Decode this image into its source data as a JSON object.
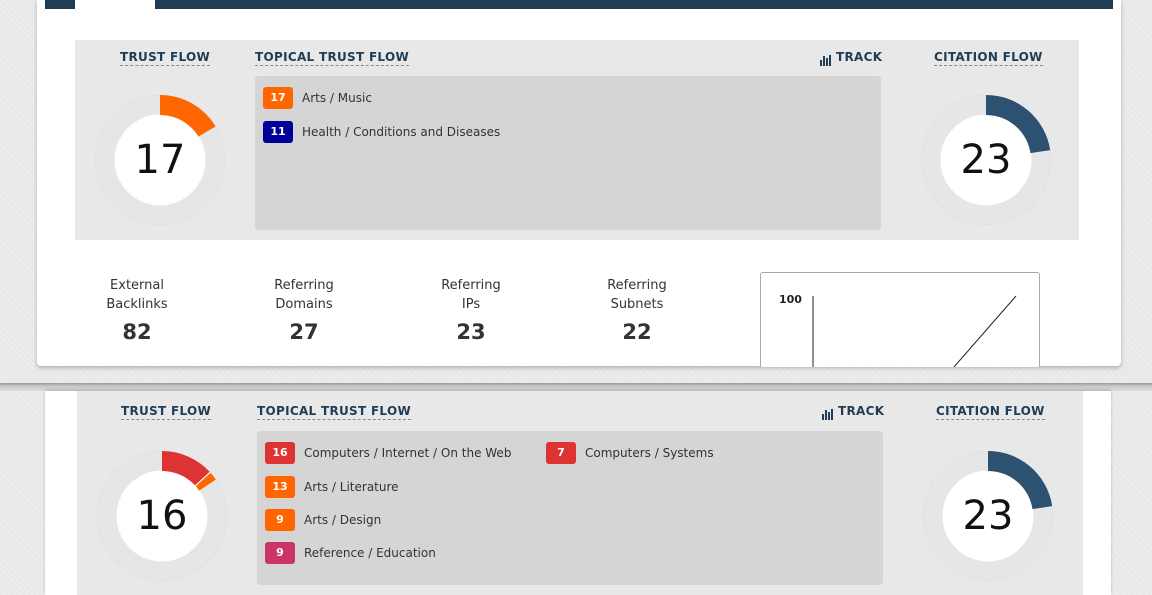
{
  "report1": {
    "trust_flow": {
      "label": "TRUST FLOW",
      "value": "17",
      "color": "#ff6600"
    },
    "topical": {
      "label": "TOPICAL TRUST FLOW",
      "items": [
        {
          "score": "17",
          "label": "Arts / Music",
          "color": "#ff6600"
        },
        {
          "score": "11",
          "label": "Health / Conditions and Diseases",
          "color": "#000099"
        }
      ]
    },
    "track_label": "TRACK",
    "citation_flow": {
      "label": "CITATION FLOW",
      "value": "23",
      "color": "#2c5171"
    },
    "stats": [
      {
        "line1": "External",
        "line2": "Backlinks",
        "value": "82"
      },
      {
        "line1": "Referring",
        "line2": "Domains",
        "value": "27"
      },
      {
        "line1": "Referring",
        "line2": "IPs",
        "value": "23"
      },
      {
        "line1": "Referring",
        "line2": "Subnets",
        "value": "22"
      }
    ],
    "chart": {
      "y_max_label": "100"
    }
  },
  "report2": {
    "trust_flow": {
      "label": "TRUST FLOW",
      "value": "16",
      "colors": [
        "#dd3333",
        "#ff6600"
      ]
    },
    "topical": {
      "label": "TOPICAL TRUST FLOW",
      "items": [
        {
          "score": "16",
          "label": "Computers / Internet / On the Web",
          "color": "#dd3333"
        },
        {
          "score": "7",
          "label": "Computers / Systems",
          "color": "#dd3333"
        },
        {
          "score": "13",
          "label": "Arts / Literature",
          "color": "#ff6600"
        },
        {
          "score": "9",
          "label": "Arts / Design",
          "color": "#ff6600"
        },
        {
          "score": "9",
          "label": "Reference / Education",
          "color": "#cc3366"
        }
      ]
    },
    "track_label": "TRACK",
    "citation_flow": {
      "label": "CITATION FLOW",
      "value": "23",
      "color": "#2c5171"
    }
  }
}
